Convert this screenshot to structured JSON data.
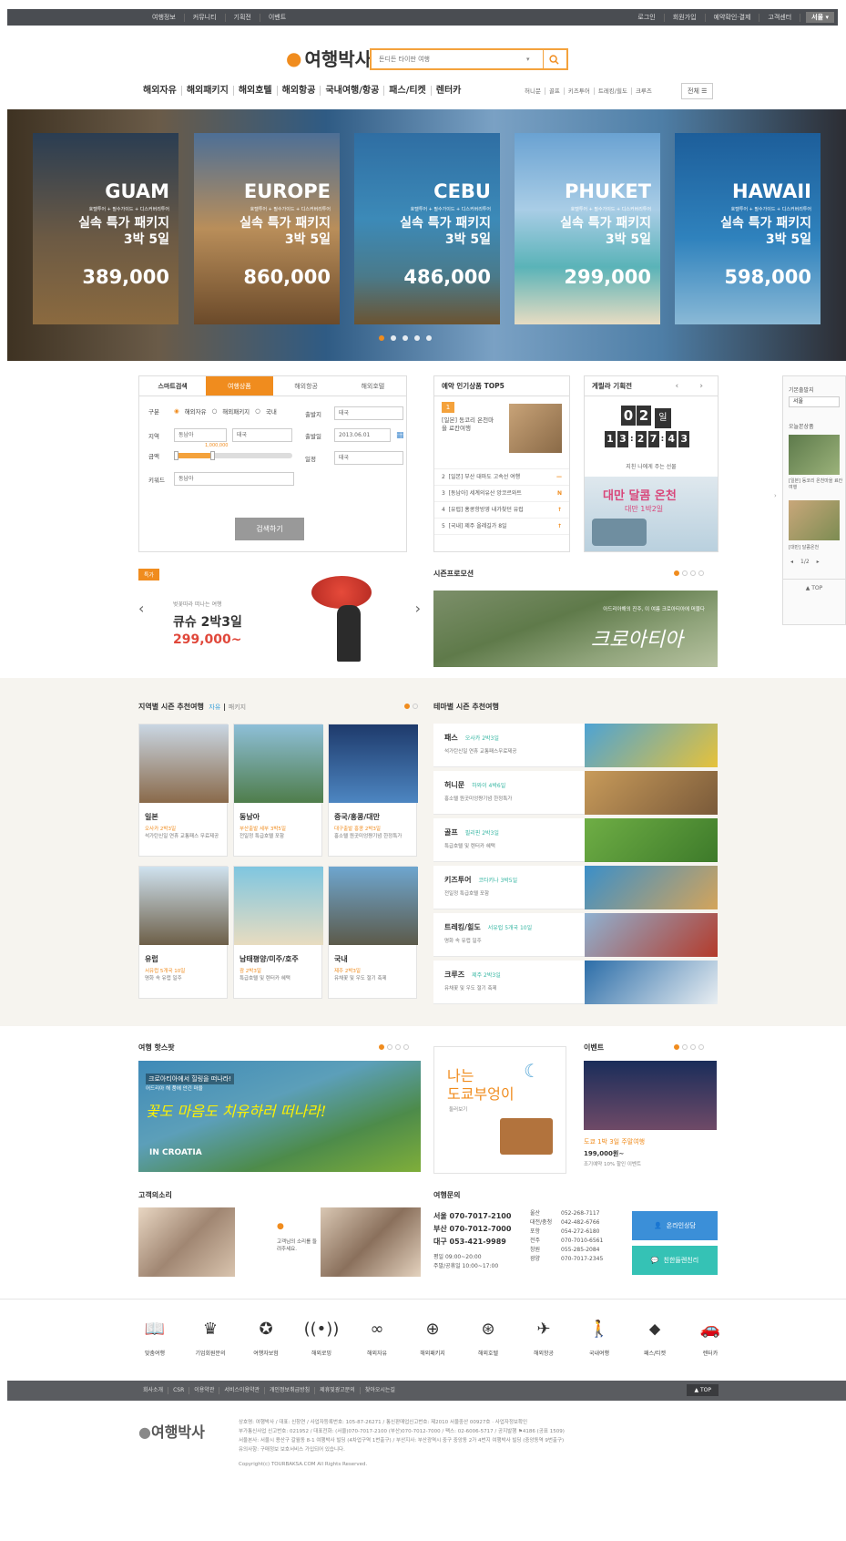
{
  "topbar": {
    "left": [
      "여행정보",
      "커뮤니티",
      "기획전",
      "이벤트"
    ],
    "right": [
      "로그인",
      "회원가입",
      "예약확인·결제",
      "고객센터"
    ],
    "lang": "서울 ▾"
  },
  "header": {
    "logo": "여행박사",
    "search_placeholder": "돈디든 타이판 여행",
    "search_option": "▾"
  },
  "gnb": [
    "해외자유",
    "해외패키지",
    "해외호텔",
    "해외항공",
    "국내여행/항공",
    "패스/티켓",
    "렌터카"
  ],
  "subnav": [
    "허니문",
    "골프",
    "키즈투어",
    "트레킹/힐도",
    "크루즈"
  ],
  "allmenu": "전체 ☰",
  "hero": {
    "cards": [
      {
        "dest": "GUAM",
        "incl": "호텔투어 + 필수가이드 + 디스커버리투어",
        "title": "실속 특가 패키지",
        "nights": "3박 5일",
        "price": "389,000"
      },
      {
        "dest": "EUROPE",
        "incl": "호텔투어 + 필수가이드 + 디스커버리투어",
        "title": "실속 특가 패키지",
        "nights": "3박 5일",
        "price": "860,000"
      },
      {
        "dest": "CEBU",
        "incl": "호텔투어 + 필수가이드 + 디스커버리투어",
        "title": "실속 특가 패키지",
        "nights": "3박 5일",
        "price": "486,000"
      },
      {
        "dest": "PHUKET",
        "incl": "호텔투어 + 필수가이드 + 디스커버리투어",
        "title": "실속 특가 패키지",
        "nights": "3박 5일",
        "price": "299,000"
      },
      {
        "dest": "HAWAII",
        "incl": "호텔투어 + 필수가이드 + 디스커버리투어",
        "title": "실속 특가 패키지",
        "nights": "3박 5일",
        "price": "598,000"
      }
    ]
  },
  "smart": {
    "label": "스마트검색",
    "tabs": [
      "여행상품",
      "해외항공",
      "해외호텔"
    ],
    "type_label": "구분",
    "types": [
      "해외자유",
      "해외패키지",
      "국내"
    ],
    "region_label": "지역",
    "region1": "동남아",
    "region2": "태국",
    "price_label": "금액",
    "price_tip": "1,000,000",
    "keyword_label": "키워드",
    "keyword": "동남아",
    "dep_label": "출발지",
    "dep": "태국",
    "date_label": "출발일",
    "date": "2013.06.01",
    "days_label": "일정",
    "days": "태국",
    "button": "검색하기"
  },
  "top5": {
    "title": "예약 인기상품 TOP5",
    "first_num": "1",
    "first": "[일본] 동코리 온천마을 료칸여행",
    "items": [
      {
        "n": "2",
        "t": "[일본] 부산 대마도 고속선 여행",
        "m": "—"
      },
      {
        "n": "3",
        "t": "[동남아] 세계의유산 앙코르와트",
        "m": "N"
      },
      {
        "n": "4",
        "t": "[유럽] 홍콩항방영 내가찾던 유럽",
        "m": "↑"
      },
      {
        "n": "5",
        "t": "[국내] 제주 올레길가 8일",
        "m": "↑"
      }
    ]
  },
  "countdown": {
    "title": "게릴라 기획전",
    "days": [
      "0",
      "2"
    ],
    "day_unit": "일",
    "h": [
      "1",
      "3"
    ],
    "m": [
      "2",
      "7"
    ],
    "s": [
      "4",
      "3"
    ],
    "caption": "지친 나에게 주는 선물",
    "promo": "대만 달콤 온천",
    "promo_sub": "대만 1박2일"
  },
  "rside": {
    "title": "기본출발지",
    "city": "서울",
    "today": "오늘본상품",
    "item": "[일본] 동코리 온천마을 료칸여행",
    "item2": "[대만] 달콤온천",
    "page": "1/2",
    "top": "▲ TOP"
  },
  "special": {
    "badge": "특가",
    "sub": "벚꽃따라 떠나는 여행",
    "title": "큐슈 2박3일",
    "price": "299,000~"
  },
  "season": {
    "title": "시즌프로모션",
    "sub": "아드리아해의 진주, 이 여름 크로아티아에 머물다",
    "script": "크로아티아"
  },
  "region": {
    "title": "지역별 시즌 추천여행",
    "tab1": "자유",
    "tab2": "패키지",
    "cards": [
      {
        "nm": "일본",
        "hl": "오사카 2박3일",
        "ds": "석가탄신일 연휴 교통패스 무료제공",
        "c1": "#c9d6e3",
        "c2": "#8a6a4a"
      },
      {
        "nm": "동남아",
        "hl": "부산출발 세부 3박5일",
        "ds": "전일정 특급호텔 포함",
        "c1": "#8ebfd8",
        "c2": "#4f7d4b"
      },
      {
        "nm": "중국/홍콩/대만",
        "hl": "대구출발 홍콩 2박3일",
        "ds": "홍소텔 원곳미엉쨩기념 한정특가",
        "c1": "#1e3a6b",
        "c2": "#4d86c1"
      },
      {
        "nm": "유럽",
        "hl": "서유럽 5개국 10일",
        "ds": "명화 속 유럽 일주",
        "c1": "#cfe2ef",
        "c2": "#6d5f48"
      },
      {
        "nm": "남태평양/미주/호주",
        "hl": "괌 2박3일",
        "ds": "특급호텔 및 렌터카 혜택",
        "c1": "#7fc6e0",
        "c2": "#e8dcc0"
      },
      {
        "nm": "국내",
        "hl": "제주 2박3일",
        "ds": "유채꽃 및 우도 절기 축제",
        "c1": "#6ea6cf",
        "c2": "#5c5a4a"
      }
    ]
  },
  "theme": {
    "title": "테마별 시즌 추천여행",
    "rows": [
      {
        "nm": "패스",
        "hl": "오사카 2박3일",
        "ds": "석가탄신일 연휴 교통패스무료제공",
        "c1": "#4da3d4",
        "c2": "#e6c23a"
      },
      {
        "nm": "허니문",
        "hl": "하와이 4박6일",
        "ds": "홍소텔 원곳미엉쨩기념 한정특가",
        "c1": "#c89b5a",
        "c2": "#7a5a3a"
      },
      {
        "nm": "골프",
        "hl": "필리핀 2박3일",
        "ds": "특급호텔 및 렌터카 혜택",
        "c1": "#6fae45",
        "c2": "#3d7a2a"
      },
      {
        "nm": "키즈투어",
        "hl": "코타키나 3박5일",
        "ds": "전일정 특급호텔 포함",
        "c1": "#3a8fc9",
        "c2": "#d4a45a"
      },
      {
        "nm": "트레킹/힐도",
        "hl": "서유럽 5개국 10일",
        "ds": "명화 속 유럽 일주",
        "c1": "#8fb2d2",
        "c2": "#b43a2a"
      },
      {
        "nm": "크루즈",
        "hl": "제주 2박3일",
        "ds": "유채꽃 및 우도 절기 축제",
        "c1": "#2b6da8",
        "c2": "#e9eef2"
      }
    ]
  },
  "hot": {
    "title": "여행 핫스팟",
    "line1": "크로아티아에서 힐링을 떠나라!",
    "line2": "어드리아 해 품에 안긴 마을",
    "script": "꽃도 마음도 치유하러 떠나라!",
    "place": "IN CROATIA"
  },
  "tokyo": {
    "t1": "나는",
    "t2": "도쿄부엉이",
    "more": "둘러보기"
  },
  "event": {
    "title": "이벤트",
    "name": "도쿄 1박 3일 주말여행",
    "price": "199,000원~",
    "desc": "조기예약 10% 할인 이벤트"
  },
  "voice": {
    "title": "고객의소리",
    "msg": "고객님의 소리를 들려주세요."
  },
  "contact": {
    "title": "여행문의",
    "main": [
      {
        "city": "서울",
        "tel": "070-7017-2100"
      },
      {
        "city": "부산",
        "tel": "070-7012-7000"
      },
      {
        "city": "대구",
        "tel": "053-421-9989"
      }
    ],
    "hours": [
      "평일 09:00~20:00",
      "주말/공휴일 10:00~17:00"
    ],
    "branches": [
      {
        "c": "울산",
        "t": "052-268-7117"
      },
      {
        "c": "대전/충청",
        "t": "042-482-6766"
      },
      {
        "c": "포항",
        "t": "054-272-6180"
      },
      {
        "c": "전주",
        "t": "070-7010-6561"
      },
      {
        "c": "창원",
        "t": "055-285-2084"
      },
      {
        "c": "광양",
        "t": "070-7017-2345"
      }
    ],
    "btn1": "온라인상담",
    "btn2": "친한들렌친리"
  },
  "quick": [
    {
      "ic": "book-icon",
      "g": "📖",
      "lb": "맞춤여행"
    },
    {
      "ic": "crown-icon",
      "g": "♛",
      "lb": "기업회원문의"
    },
    {
      "ic": "award-icon",
      "g": "✪",
      "lb": "여행자보험"
    },
    {
      "ic": "signal-icon",
      "g": "((•))",
      "lb": "해외로밍"
    },
    {
      "ic": "infinity-icon",
      "g": "∞",
      "lb": "해외자유"
    },
    {
      "ic": "globe-icon",
      "g": "⊕",
      "lb": "해외패키지"
    },
    {
      "ic": "hotel-globe-icon",
      "g": "⊛",
      "lb": "해외호텔"
    },
    {
      "ic": "plane-icon",
      "g": "✈",
      "lb": "해외항공"
    },
    {
      "ic": "walker-icon",
      "g": "🚶",
      "lb": "국내여행"
    },
    {
      "ic": "tag-icon",
      "g": "⬥",
      "lb": "패스/티켓"
    },
    {
      "ic": "car-icon",
      "g": "🚗",
      "lb": "렌터카"
    }
  ],
  "footer": {
    "links": [
      "회사소개",
      "CSR",
      "이용약관",
      "서비스이용약관",
      "개인정보취급방침",
      "제휴및광고문의",
      "찾아오시는길"
    ],
    "top": "▲ TOP",
    "logo": "여행박사",
    "info": [
      "상호명: 여행박사 / 대표: 신창연 / 사업자등록번호: 105-87-26271 / 통신판매업신고번호: 제2010 서울중산 00927호 · 사업자정보확인",
      "부가통신사업 신고번호: 021952 / 대표전화: (서울)070-7017-2100 (부산)070-7012-7000 / 팩스: 02-6006-5717 / 공지발행 ⚑4186 (공표 1509)",
      "서울본사: 서울시 용산구 갈월동 8-1 여행박사 빌딩 (4차업구역 1번출구) / 부산지사: 부산광역시 중구 중앙동 2가 4번지 여행박사 빌딩 (중앙동역 9번출구)",
      "유의사항: 구매정보 보호서비스 가입되어 있습니다.",
      "Copyright(c) TOURBAKSA.COM All Rights Reserved."
    ]
  }
}
